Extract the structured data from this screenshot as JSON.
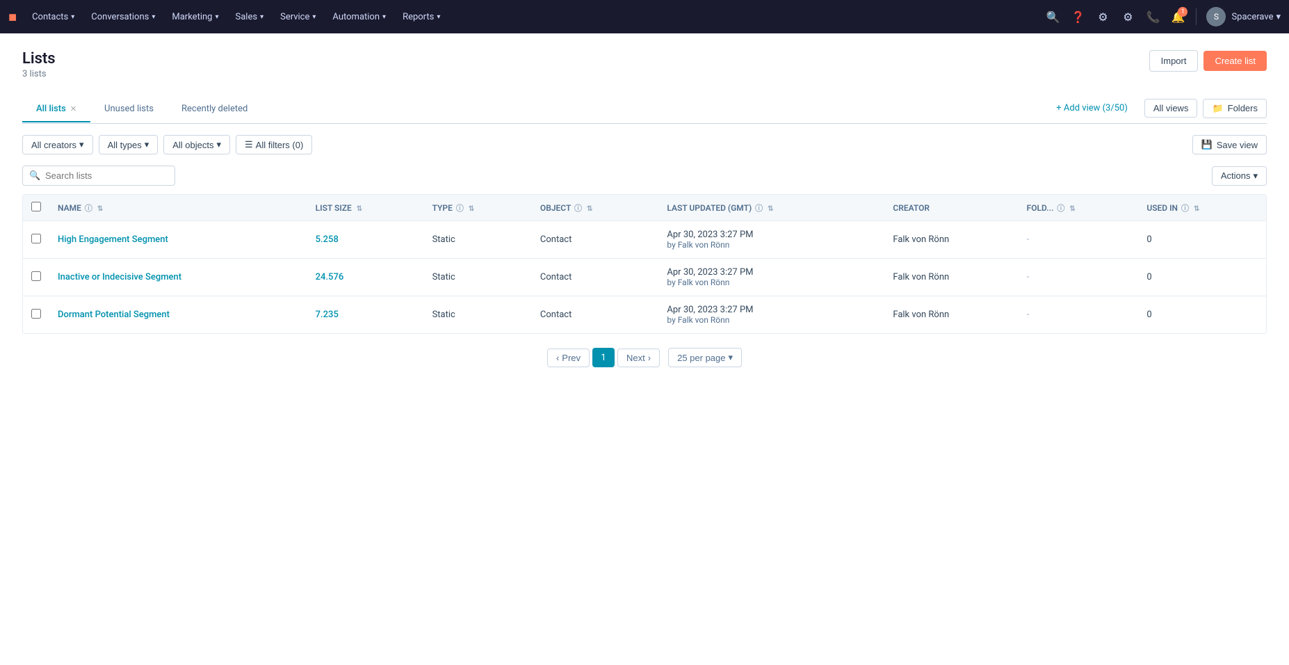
{
  "nav": {
    "logo": "H",
    "items": [
      {
        "label": "Contacts",
        "hasMenu": true
      },
      {
        "label": "Conversations",
        "hasMenu": true
      },
      {
        "label": "Marketing",
        "hasMenu": true
      },
      {
        "label": "Sales",
        "hasMenu": true
      },
      {
        "label": "Service",
        "hasMenu": true
      },
      {
        "label": "Automation",
        "hasMenu": true
      },
      {
        "label": "Reports",
        "hasMenu": true
      }
    ],
    "account": "Spacerave",
    "notification_count": "1"
  },
  "page": {
    "title": "Lists",
    "subtitle": "3 lists"
  },
  "buttons": {
    "import": "Import",
    "create": "Create list",
    "all_views": "All views",
    "folders": "Folders",
    "save_view": "Save view",
    "actions": "Actions",
    "add_view": "+ Add view (3/50)",
    "prev": "Prev",
    "next": "Next"
  },
  "tabs": [
    {
      "label": "All lists",
      "active": true,
      "closeable": true
    },
    {
      "label": "Unused lists",
      "active": false,
      "closeable": false
    },
    {
      "label": "Recently deleted",
      "active": false,
      "closeable": false
    }
  ],
  "filters": {
    "creators": "All creators",
    "types": "All types",
    "objects": "All objects",
    "all_filters": "All filters (0)"
  },
  "search": {
    "placeholder": "Search lists"
  },
  "table": {
    "columns": [
      {
        "label": "NAME",
        "hasInfo": true,
        "sortable": true
      },
      {
        "label": "LIST SIZE",
        "hasInfo": false,
        "sortable": true
      },
      {
        "label": "TYPE",
        "hasInfo": true,
        "sortable": true
      },
      {
        "label": "OBJECT",
        "hasInfo": true,
        "sortable": true
      },
      {
        "label": "LAST UPDATED (GMT)",
        "hasInfo": true,
        "sortable": true
      },
      {
        "label": "CREATOR",
        "hasInfo": false,
        "sortable": false
      },
      {
        "label": "FOLD...",
        "hasInfo": true,
        "sortable": true
      },
      {
        "label": "USED IN",
        "hasInfo": true,
        "sortable": true
      }
    ],
    "rows": [
      {
        "name": "High Engagement Segment",
        "size": "5.258",
        "type": "Static",
        "object": "Contact",
        "lastUpdated": "Apr 30, 2023 3:27 PM",
        "updatedBy": "by Falk von Rönn",
        "creator": "Falk von Rönn",
        "folder": "-",
        "usedIn": "0"
      },
      {
        "name": "Inactive or Indecisive Segment",
        "size": "24.576",
        "type": "Static",
        "object": "Contact",
        "lastUpdated": "Apr 30, 2023 3:27 PM",
        "updatedBy": "by Falk von Rönn",
        "creator": "Falk von Rönn",
        "folder": "-",
        "usedIn": "0"
      },
      {
        "name": "Dormant Potential Segment",
        "size": "7.235",
        "type": "Static",
        "object": "Contact",
        "lastUpdated": "Apr 30, 2023 3:27 PM",
        "updatedBy": "by Falk von Rönn",
        "creator": "Falk von Rönn",
        "folder": "-",
        "usedIn": "0"
      }
    ]
  },
  "pagination": {
    "current_page": "1",
    "per_page": "25 per page"
  }
}
